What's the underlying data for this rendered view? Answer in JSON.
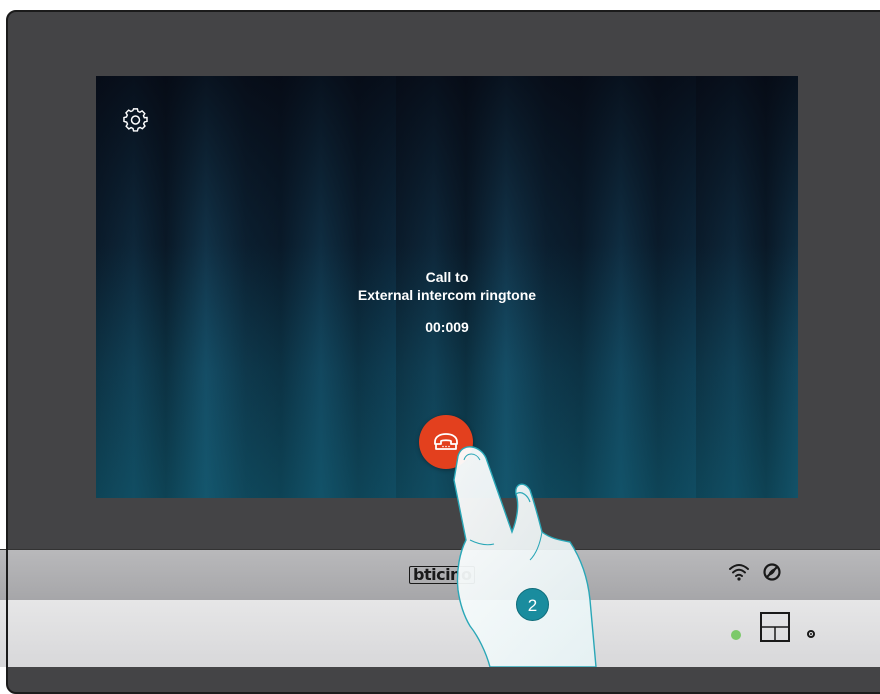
{
  "call": {
    "line1": "Call to",
    "line2": "External intercom ringtone",
    "timer": "00:009"
  },
  "device": {
    "brand": "bticino"
  },
  "step": {
    "number": "2"
  },
  "icons": {
    "settings": "gear-icon",
    "hangup": "phone-hangup-icon",
    "wifi": "wifi-icon",
    "mute": "mute-icon",
    "led": "status-led",
    "keypad": "keypad-icon",
    "mic": "microphone-icon"
  },
  "colors": {
    "hangup": "#e3401e",
    "step_badge": "#1a8c9e",
    "led": "#7cc96a"
  }
}
